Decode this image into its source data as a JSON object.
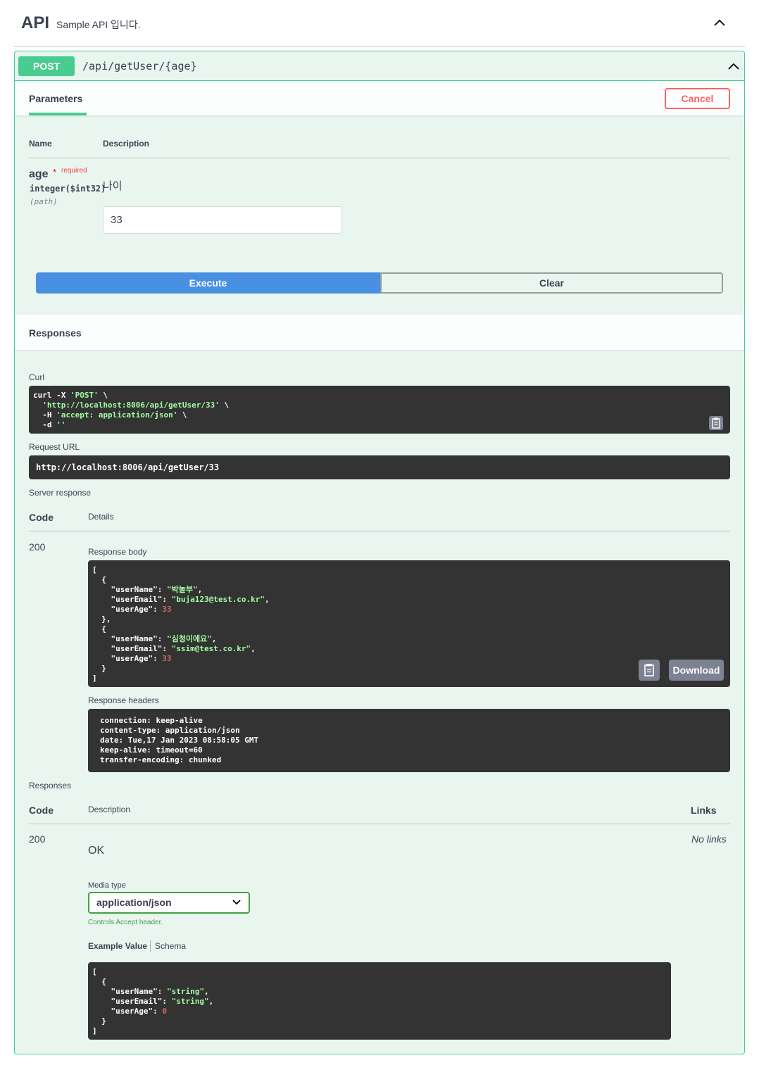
{
  "tag": {
    "title": "API",
    "description": "Sample API 입니다."
  },
  "operation": {
    "method": "POST",
    "path": "/api/getUser/{age}"
  },
  "params_section": {
    "tab_label": "Parameters",
    "cancel_label": "Cancel",
    "col_name": "Name",
    "col_description": "Description"
  },
  "param": {
    "name": "age",
    "required_star": "*",
    "required_label": "required",
    "type": "integer($int32)",
    "location": "(path)",
    "description": "나이",
    "value": "33"
  },
  "actions": {
    "execute_label": "Execute",
    "clear_label": "Clear"
  },
  "responses_section": {
    "title": "Responses",
    "curl_label": "Curl",
    "curl_lines": [
      {
        "plain": "curl -X ",
        "str": "'POST'",
        "tail": " \\"
      },
      {
        "plain": "  ",
        "str": "'http://localhost:8006/api/getUser/33'",
        "tail": " \\"
      },
      {
        "plain": "  -H ",
        "str": "'accept: application/json'",
        "tail": " \\"
      },
      {
        "plain": "  -d ",
        "str": "''",
        "tail": ""
      }
    ],
    "request_url_label": "Request URL",
    "request_url": "http://localhost:8006/api/getUser/33",
    "server_response_label": "Server response",
    "col_code": "Code",
    "col_details": "Details",
    "status_code": "200",
    "response_body_label": "Response body",
    "download_label": "Download",
    "response_body": [
      {
        "userName": "박놀부",
        "userEmail": "buja123@test.co.kr",
        "userAge": 33
      },
      {
        "userName": "심청이에요",
        "userEmail": "ssim@test.co.kr",
        "userAge": 33
      }
    ],
    "response_headers_label": "Response headers",
    "response_headers": [
      "connection: keep-alive",
      "content-type: application/json",
      "date: Tue,17 Jan 2023 08:58:05 GMT",
      "keep-alive: timeout=60",
      "transfer-encoding: chunked"
    ]
  },
  "responses_doc": {
    "title": "Responses",
    "col_code": "Code",
    "col_description": "Description",
    "col_links": "Links",
    "code": "200",
    "no_links": "No links",
    "description": "OK",
    "media_type_label": "Media type",
    "media_type_value": "application/json",
    "media_type_hint": "Controls Accept header.",
    "example_tab": "Example Value",
    "schema_tab": "Schema",
    "example": [
      {
        "userName": "string",
        "userEmail": "string",
        "userAge": 0
      }
    ]
  },
  "colors": {
    "post": "#49cc90",
    "execute": "#4990e2",
    "cancel": "#ff6060",
    "code_bg": "#333333"
  }
}
